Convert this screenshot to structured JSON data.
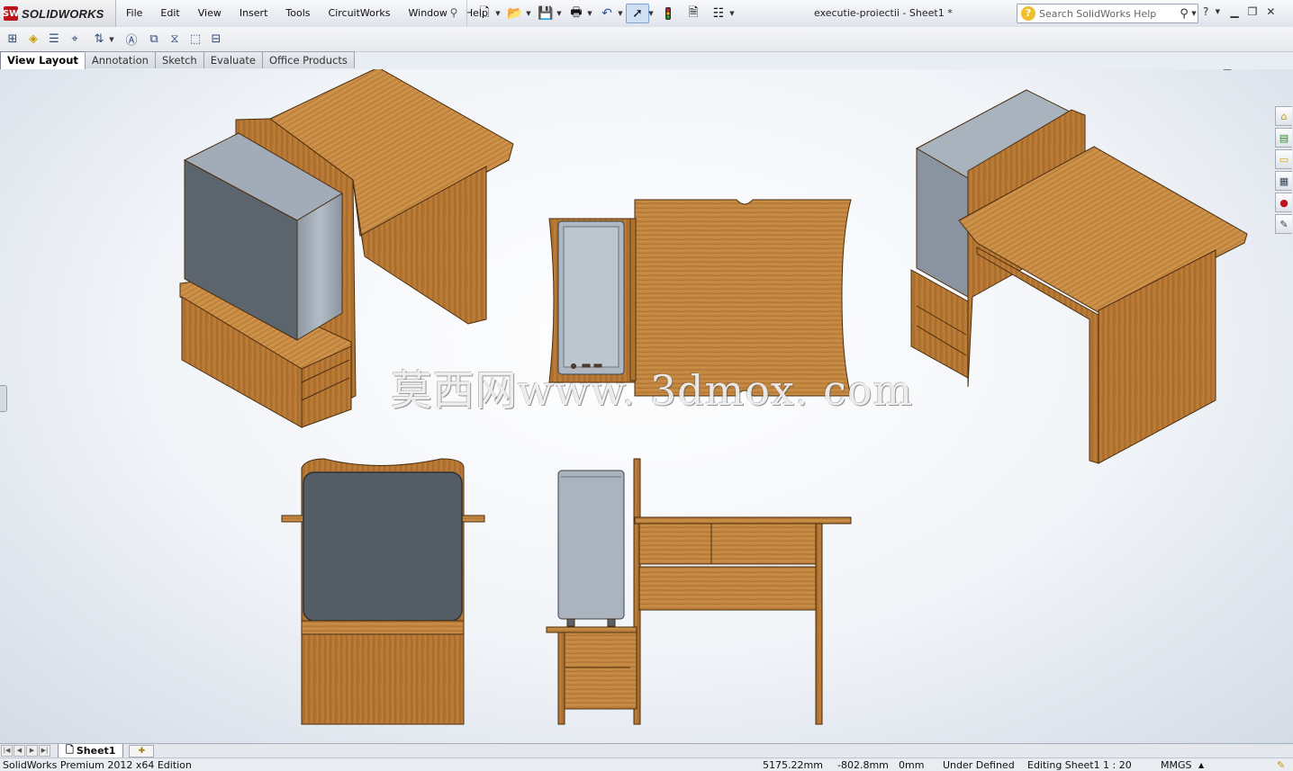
{
  "app": {
    "brand": "SOLIDWORKS",
    "logo_mark": "SW"
  },
  "menu": [
    "File",
    "Edit",
    "View",
    "Insert",
    "Tools",
    "CircuitWorks",
    "Window",
    "Help"
  ],
  "document_title": "executie-proiectii - Sheet1 *",
  "search": {
    "placeholder": "Search SolidWorks Help"
  },
  "tabs": [
    "View Layout",
    "Annotation",
    "Sketch",
    "Evaluate",
    "Office Products"
  ],
  "active_tab": "View Layout",
  "watermark": "莫西网www. 3dmox. com",
  "sheet_tab": "Sheet1",
  "status": {
    "edition": "SolidWorks Premium 2012 x64 Edition",
    "x": "5175.22mm",
    "y": "-802.8mm",
    "z": "0mm",
    "definition": "Under Defined",
    "editing": "Editing Sheet1",
    "scale": "1 : 20",
    "units": "MMGS"
  },
  "colors": {
    "wood": "#b97a35",
    "wood_dark": "#8a5520",
    "metal_light": "#a9b3bf",
    "metal_dark": "#59616b",
    "brand_red": "#c0141c"
  }
}
